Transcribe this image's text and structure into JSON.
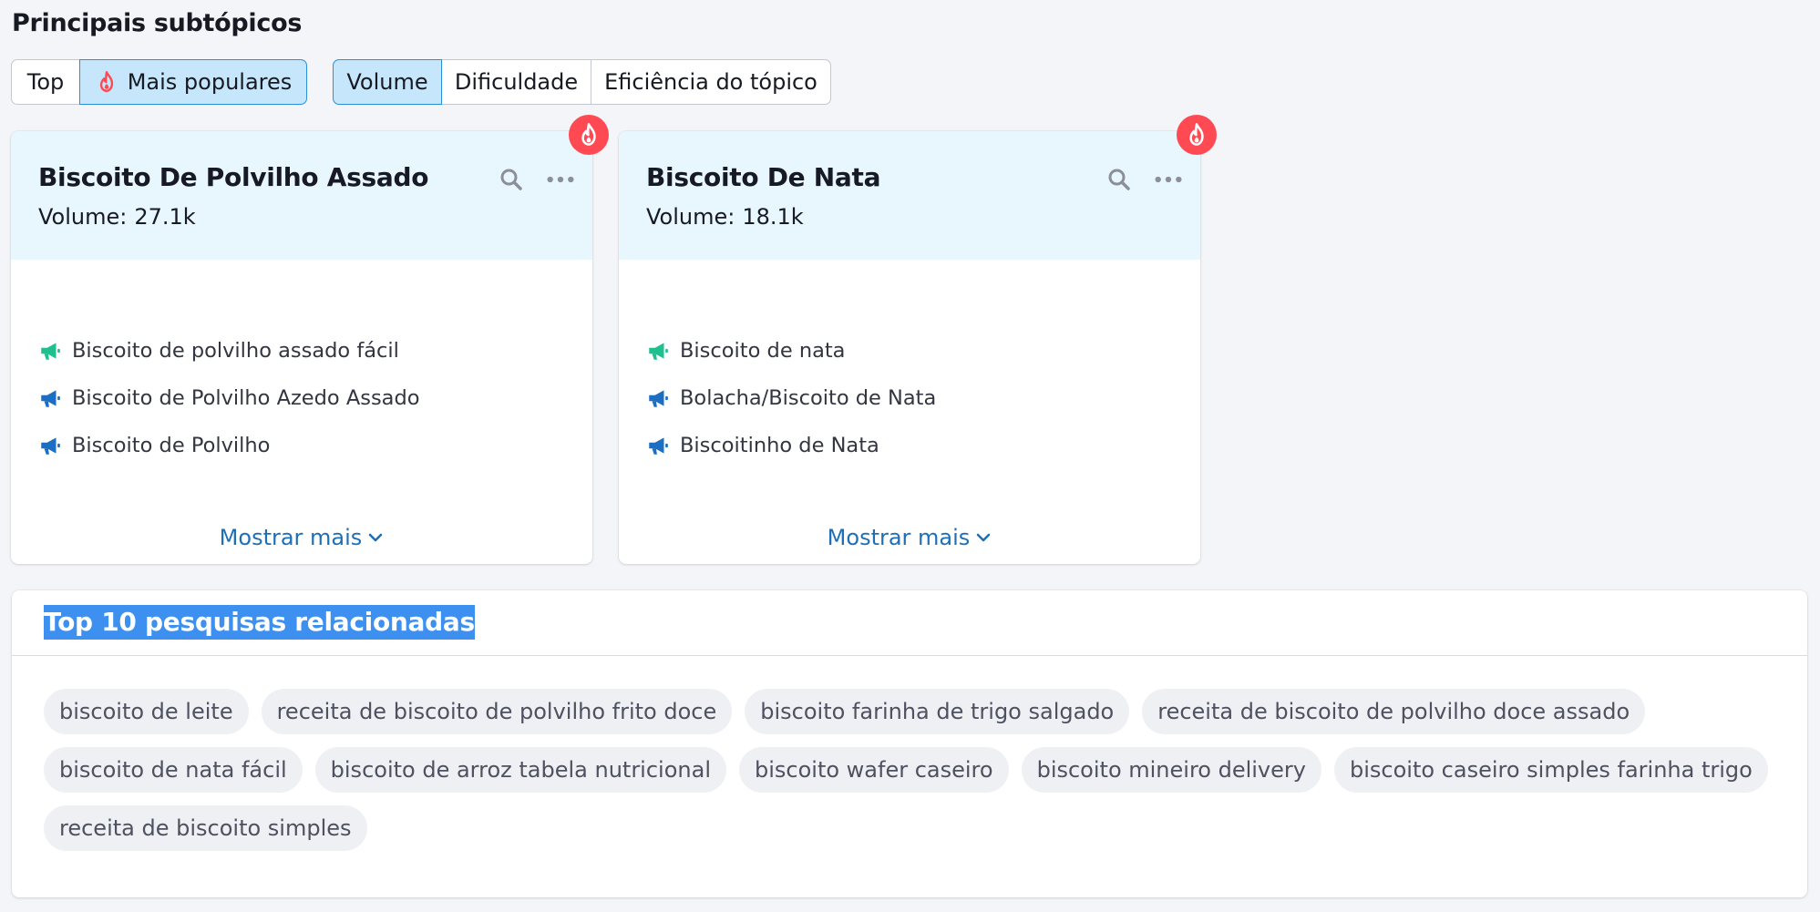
{
  "title": "Principais subtópicos",
  "sort_tabs": [
    {
      "label": "Top",
      "active": false,
      "icon": null
    },
    {
      "label": "Mais populares",
      "active": true,
      "icon": "flame-icon"
    }
  ],
  "metric_tabs": [
    {
      "label": "Volume",
      "active": true
    },
    {
      "label": "Dificuldade",
      "active": false
    },
    {
      "label": "Eficiência do tópico",
      "active": false
    }
  ],
  "cards": [
    {
      "title": "Biscoito De Polvilho Assado",
      "volume_label": "Volume:",
      "volume_value": "27.1k",
      "badge_icon": "flame-icon",
      "items": [
        {
          "label": "Biscoito de polvilho assado fácil",
          "icon": "megaphone-icon",
          "color": "#1fbf8f"
        },
        {
          "label": "Biscoito de Polvilho Azedo Assado",
          "icon": "megaphone-icon",
          "color": "#1b6ec2"
        },
        {
          "label": "Biscoito de Polvilho",
          "icon": "megaphone-icon",
          "color": "#1b6ec2"
        }
      ],
      "show_more": "Mostrar mais"
    },
    {
      "title": "Biscoito De Nata",
      "volume_label": "Volume:",
      "volume_value": "18.1k",
      "badge_icon": "flame-icon",
      "items": [
        {
          "label": "Biscoito de nata",
          "icon": "megaphone-icon",
          "color": "#1fbf8f"
        },
        {
          "label": "Bolacha/Biscoito de Nata",
          "icon": "megaphone-icon",
          "color": "#1b6ec2"
        },
        {
          "label": "Biscoitinho de Nata",
          "icon": "megaphone-icon",
          "color": "#1b6ec2"
        }
      ],
      "show_more": "Mostrar mais"
    }
  ],
  "related": {
    "title": "Top 10 pesquisas relacionadas",
    "tags": [
      "biscoito de leite",
      "receita de biscoito de polvilho frito doce",
      "biscoito farinha de trigo salgado",
      "receita de biscoito de polvilho doce assado",
      "biscoito de nata fácil",
      "biscoito de arroz tabela nutricional",
      "biscoito wafer caseiro",
      "biscoito mineiro delivery",
      "biscoito caseiro simples farinha trigo",
      "receita de biscoito simples"
    ]
  },
  "colors": {
    "accent_blue": "#1f6fb6",
    "active_tab_bg": "#c6e6fb",
    "flame_red": "#ff4953",
    "selection_bg": "#3d8ff0"
  }
}
